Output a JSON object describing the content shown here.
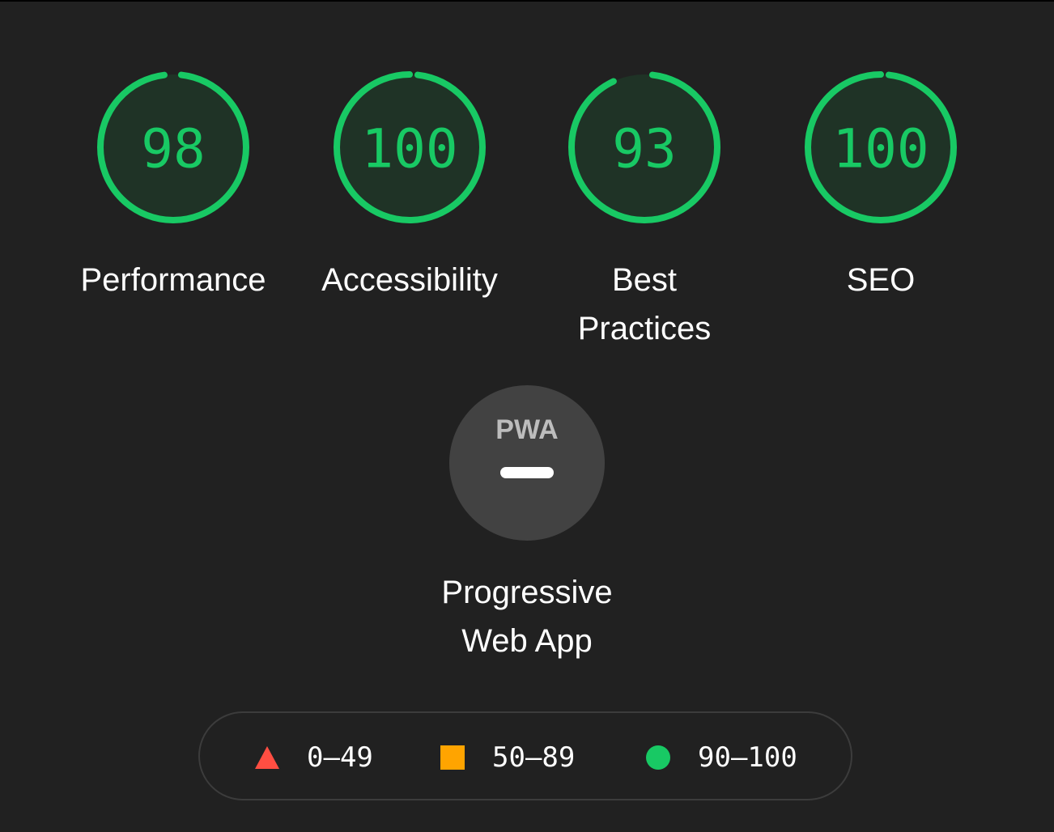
{
  "colors": {
    "pass": "#18c964",
    "pass_track": "#1f3326",
    "average": "#ffa400",
    "fail": "#ff4e42",
    "background": "#212121",
    "pwa_badge": "#424242"
  },
  "gauges": [
    {
      "score": "98",
      "value": 98,
      "label_lines": [
        "Performance"
      ]
    },
    {
      "score": "100",
      "value": 100,
      "label_lines": [
        "Accessibility"
      ]
    },
    {
      "score": "93",
      "value": 93,
      "label_lines": [
        "Best",
        "Practices"
      ]
    },
    {
      "score": "100",
      "value": 100,
      "label_lines": [
        "SEO"
      ]
    }
  ],
  "pwa": {
    "logo_text": "PWA",
    "label_lines": [
      "Progressive",
      "Web App"
    ],
    "icon": "dash-icon"
  },
  "legend": [
    {
      "shape": "triangle-icon",
      "range": "0–49"
    },
    {
      "shape": "square-icon",
      "range": "50–89"
    },
    {
      "shape": "circle-icon",
      "range": "90–100"
    }
  ]
}
